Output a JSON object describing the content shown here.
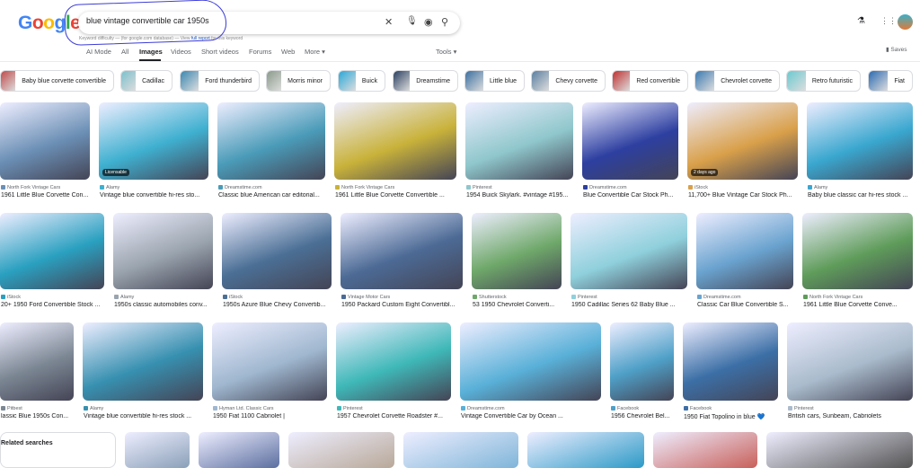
{
  "header": {
    "logo": "Google",
    "query": "blue vintage convertible car 1950s",
    "keyword_note_pre": "Keyword difficulty — (for google.com database) — View ",
    "keyword_note_link": "full report",
    "keyword_note_post": " for this keyword",
    "saves": "Saves"
  },
  "icons": [
    "clear-icon",
    "mic-icon",
    "lens-icon",
    "search-icon",
    "labs-icon",
    "apps-icon",
    "avatar"
  ],
  "tabs": [
    {
      "label": "AI Mode"
    },
    {
      "label": "All"
    },
    {
      "label": "Images",
      "active": true
    },
    {
      "label": "Videos"
    },
    {
      "label": "Short videos"
    },
    {
      "label": "Forums"
    },
    {
      "label": "Web"
    },
    {
      "label": "More ▾"
    }
  ],
  "tools": "Tools ▾",
  "chips": [
    "Baby blue corvette convertible",
    "Cadillac",
    "Ford thunderbird",
    "Morris minor",
    "Buick",
    "Dreamstime",
    "Little blue",
    "Chevy corvette",
    "Red convertible",
    "Chevrolet corvette",
    "Retro futuristic",
    "Fiat"
  ],
  "results": [
    [
      {
        "source": "North Fork Vintage Cars",
        "title": "1961 Little Blue Corvette Con...",
        "c": "#6b8fb5"
      },
      {
        "source": "Alamy",
        "title": "Vintage blue convertible hi-res sto...",
        "c": "#3fb0d0",
        "badge": "Licensable"
      },
      {
        "source": "Dreamstime.com",
        "title": "Classic blue American car editorial...",
        "c": "#4a9bb8"
      },
      {
        "source": "North Fork Vintage Cars",
        "title": "1961 Little Blue Corvette Convertible ...",
        "c": "#c9b23a"
      },
      {
        "source": "Pinterest",
        "title": "1954 Buick Skylark. #vintage #195...",
        "c": "#8fc7cc"
      },
      {
        "source": "Dreamstime.com",
        "title": "Blue Convertible Car Stock Ph...",
        "c": "#2d3fa0"
      },
      {
        "source": "iStock",
        "title": "11,700+ Blue Vintage Car Stock Ph...",
        "c": "#d9a04a",
        "badge": "2 days ago"
      },
      {
        "source": "Alamy",
        "title": "Baby blue classic car hi-res stock ...",
        "c": "#3aa7cf"
      }
    ],
    [
      {
        "source": "iStock",
        "title": "20+ 1950 Ford Convertible Stock ...",
        "c": "#2aa0c0"
      },
      {
        "source": "Alamy",
        "title": "1950s classic automobiles conv...",
        "c": "#9aa4ae"
      },
      {
        "source": "iStock",
        "title": "1950s Azure Blue Chevy Convertib...",
        "c": "#4b6f95"
      },
      {
        "source": "Vintage Motor Cars",
        "title": "1950 Packard Custom Eight Convertibl...",
        "c": "#4c6a95"
      },
      {
        "source": "Shutterstock",
        "title": "53 1950 Chevrolet Converti...",
        "c": "#6fa86a"
      },
      {
        "source": "Pinterest",
        "title": "1950 Cadillac Series 62 Baby Blue ...",
        "c": "#8fd0dc"
      },
      {
        "source": "Dreamstime.com",
        "title": "Classic Car Blue Convertible S...",
        "c": "#6aa3cf"
      },
      {
        "source": "North Fork Vintage Cars",
        "title": "1961 Little Blue Corvette Conve...",
        "c": "#5f9c5a"
      }
    ],
    [
      {
        "source": "Pitbest",
        "title": "lassic Blue 1950s Con...",
        "c": "#7c8794"
      },
      {
        "source": "Alamy",
        "title": "Vintage blue convertible hi-res stock ...",
        "c": "#3790b0"
      },
      {
        "source": "Hyman Ltd. Classic Cars",
        "title": "1950 Fiat 1100 Cabriolet |",
        "c": "#9fb7cf"
      },
      {
        "source": "Pinterest",
        "title": "1957 Chevrolet Corvette Roadster #...",
        "c": "#3fb8b8"
      },
      {
        "source": "Dreamstime.com",
        "title": "Vintage Convertible Car by Ocean ...",
        "c": "#59b0d8"
      },
      {
        "source": "Facebook",
        "title": "1956 Chevrolet Bel...",
        "c": "#4fa0c8"
      },
      {
        "source": "Facebook",
        "title": "1950 Fiat Topolino in blue 💙",
        "c": "#3c6fa6"
      },
      {
        "source": "Pinterest",
        "title": "British cars, Sunbeam, Cabriolets",
        "c": "#a9bbcc"
      }
    ]
  ],
  "related": {
    "label": "Related searches"
  },
  "bottom_colors": [
    "#8aa0b8",
    "#5c6fa0",
    "#b8a898",
    "#7fb5d9",
    "#2c9ac7",
    "#c8605a",
    "#555"
  ]
}
